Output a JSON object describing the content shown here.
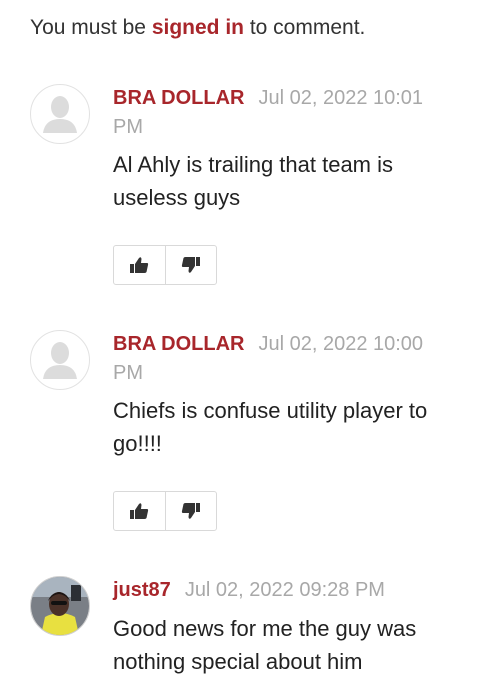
{
  "signin_prompt": {
    "prefix": "You must be ",
    "link": "signed in",
    "suffix": " to comment."
  },
  "comments": [
    {
      "author": "BRA DOLLAR",
      "date": "Jul 02, 2022 10:01 PM",
      "text": "Al Ahly is trailing that team is useless guys",
      "avatar": "default-avatar-icon"
    },
    {
      "author": "BRA DOLLAR",
      "date": "Jul 02, 2022 10:00 PM",
      "text": "Chiefs is confuse utility player to go!!!!",
      "avatar": "default-avatar-icon"
    },
    {
      "author": "just87",
      "date": "Jul 02, 2022 09:28 PM",
      "text": "Good news for me the guy was nothing special about him",
      "avatar": "user-photo"
    }
  ],
  "icons": {
    "upvote": "thumbs-up-icon",
    "downvote": "thumbs-down-icon"
  },
  "colors": {
    "accent": "#a8262b",
    "date": "#a8a8a8",
    "border": "#d9d9d9"
  }
}
